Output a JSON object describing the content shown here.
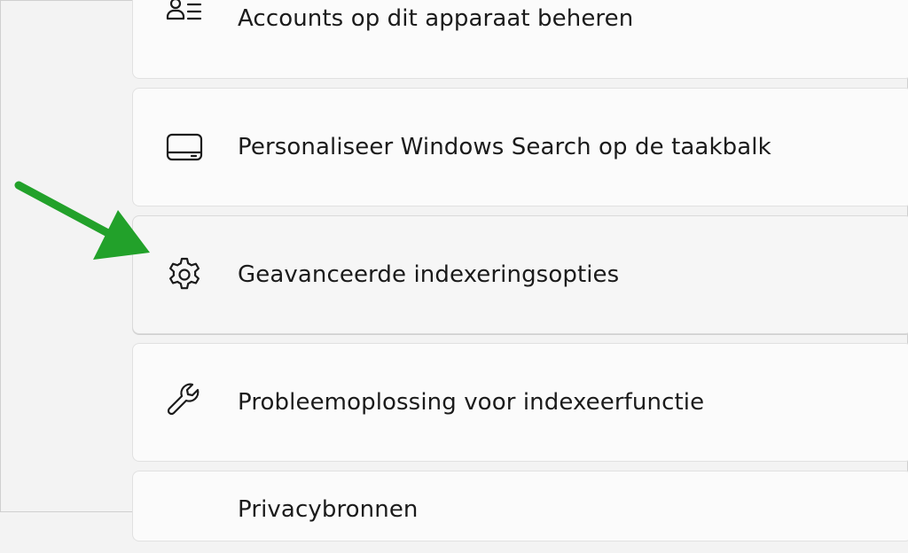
{
  "settings": {
    "items": [
      {
        "label": "Accounts op dit apparaat beheren",
        "icon": "accounts-list-icon"
      },
      {
        "label": "Personaliseer Windows Search op de taakbalk",
        "icon": "taskbar-icon"
      },
      {
        "label": "Geavanceerde indexeringsopties",
        "icon": "gear-icon"
      },
      {
        "label": "Probleemoplossing voor indexeerfunctie",
        "icon": "wrench-icon"
      },
      {
        "label": "Privacybronnen",
        "icon": ""
      }
    ]
  },
  "colors": {
    "arrow": "#22a12a",
    "card_background": "#fbfbfb",
    "card_hover_background": "#f6f6f6",
    "page_background": "#f3f3f3",
    "text": "#1b1b1b"
  },
  "icons": {
    "annotation": "green-arrow-icon"
  }
}
